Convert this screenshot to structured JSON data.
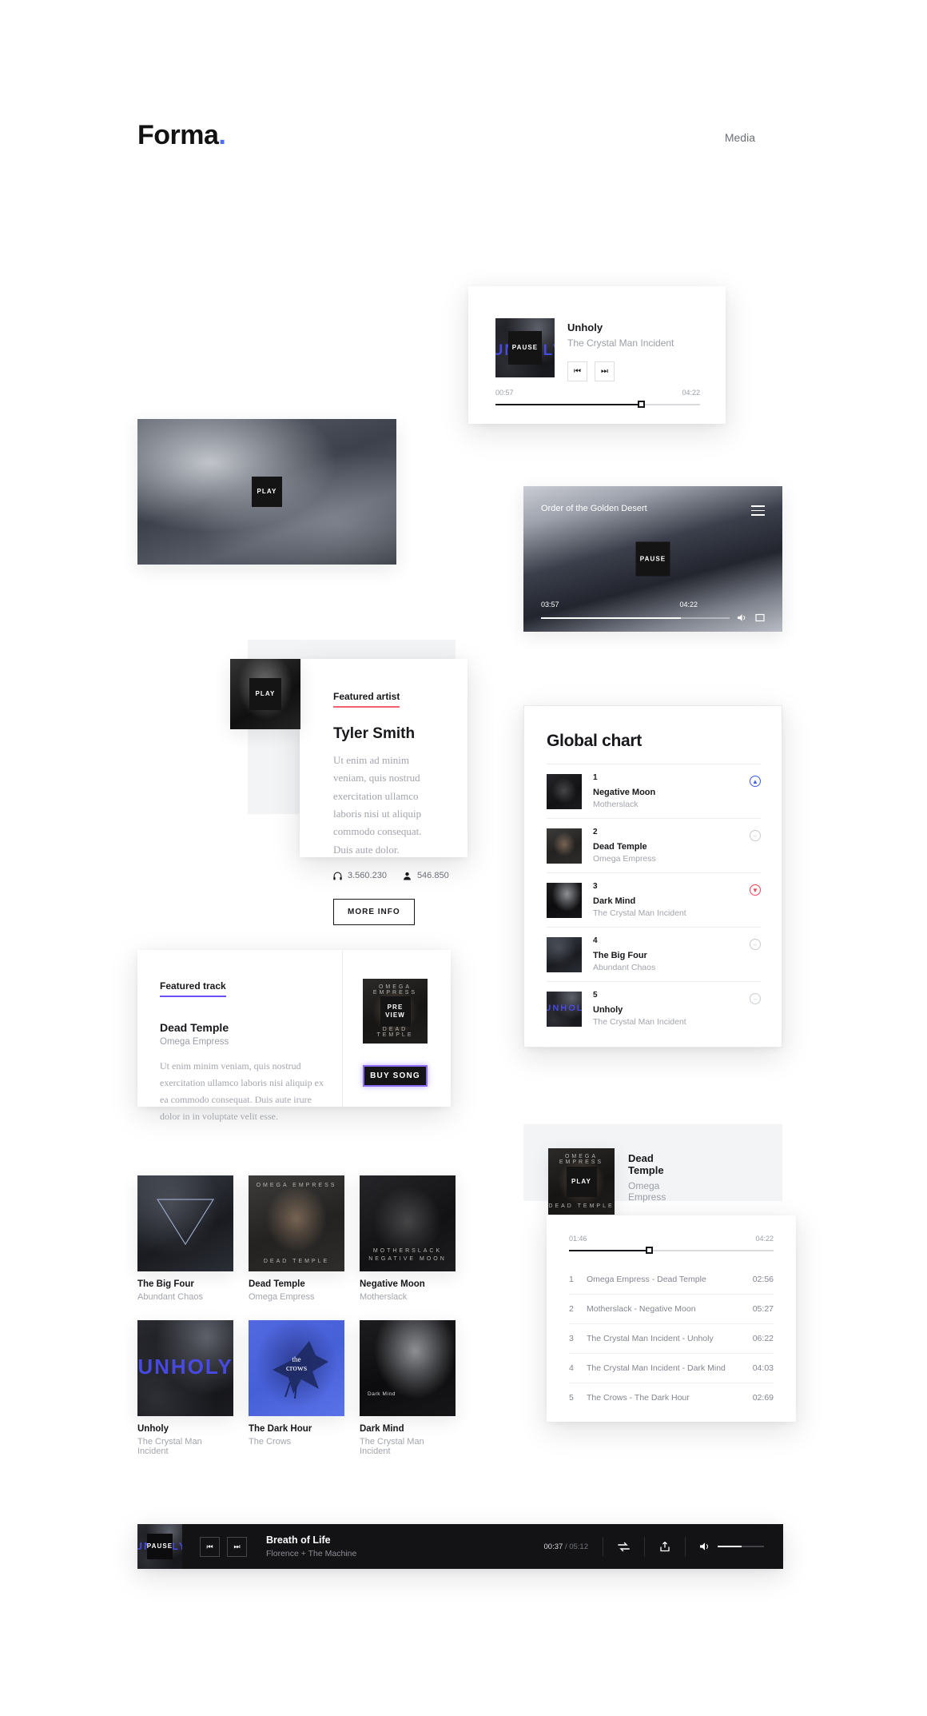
{
  "header": {
    "logo": "Forma",
    "logo_dot": ".",
    "nav": "Media"
  },
  "player_card": {
    "title": "Unholy",
    "artist": "The Crystal Man Incident",
    "overlay_label": "PAUSE",
    "art_text": "UNHOLY",
    "time_current": "00:57",
    "time_total": "04:22",
    "progress_pct": 71,
    "prev_icon": "skip-previous-icon",
    "next_icon": "skip-next-icon"
  },
  "hero_video": {
    "overlay_label": "PLAY"
  },
  "video_player": {
    "title": "Order of the Golden Desert",
    "overlay_label": "PAUSE",
    "time_current": "03:57",
    "time_total": "04:22",
    "progress_pct": 74,
    "menu_icon": "hamburger-icon",
    "volume_icon": "volume-icon",
    "fullscreen_icon": "fullscreen-icon"
  },
  "featured_artist": {
    "kicker": "Featured artist",
    "name": "Tyler Smith",
    "description": "Ut enim ad minim veniam, quis nostrud exercitation ullamco laboris nisi ut aliquip commodo consequat. Duis aute dolor.",
    "plays": "3.560.230",
    "followers": "546.850",
    "plays_icon": "headphones-icon",
    "followers_icon": "user-icon",
    "button": "MORE INFO",
    "overlay_label": "PLAY"
  },
  "global_chart": {
    "title": "Global chart",
    "rows": [
      {
        "rank": "1",
        "name": "Negative Moon",
        "artist": "Motherslack",
        "trend": "up",
        "trend_icon": "chevron-up-circle-icon"
      },
      {
        "rank": "2",
        "name": "Dead Temple",
        "artist": "Omega Empress",
        "trend": "flat",
        "trend_icon": "minus-circle-icon"
      },
      {
        "rank": "3",
        "name": "Dark Mind",
        "artist": "The Crystal Man Incident",
        "trend": "down",
        "trend_icon": "chevron-down-circle-icon"
      },
      {
        "rank": "4",
        "name": "The Big Four",
        "artist": "Abundant Chaos",
        "trend": "flat",
        "trend_icon": "minus-circle-icon"
      },
      {
        "rank": "5",
        "name": "Unholy",
        "artist": "The Crystal Man Incident",
        "trend": "flat",
        "trend_icon": "minus-circle-icon"
      }
    ]
  },
  "featured_track": {
    "kicker": "Featured track",
    "name": "Dead Temple",
    "artist": "Omega Empress",
    "description": "Ut enim minim veniam, quis nostrud exercitation ullamco laboris nisi aliquip ex ea commodo consequat. Duis aute irure dolor in in voluptate velit esse.",
    "preview_label_1": "PRE",
    "preview_label_2": "VIEW",
    "buy_label": "BUY SONG"
  },
  "albums": [
    {
      "name": "The Big Four",
      "artist": "Abundant Chaos"
    },
    {
      "name": "Dead Temple",
      "artist": "Omega Empress"
    },
    {
      "name": "Negative Moon",
      "artist": "Motherslack"
    },
    {
      "name": "Unholy",
      "artist": "The Crystal Man Incident"
    },
    {
      "name": "The Dark Hour",
      "artist": "The Crows"
    },
    {
      "name": "Dark Mind",
      "artist": "The Crystal Man Incident"
    }
  ],
  "album_art_labels": {
    "temple_top": "OMEGA EMPRESS",
    "temple_bottom": "DEAD TEMPLE",
    "typewriter_top": "MOTHERSLACK",
    "typewriter_bottom": "NEGATIVE MOON",
    "unholy": "UNHOLY",
    "crows_1": "the",
    "crows_2": "crows",
    "darkmind": "Dark Mind"
  },
  "playlist_player": {
    "title": "Dead Temple",
    "artist": "Omega Empress",
    "overlay_label": "PLAY",
    "time_current": "01:46",
    "time_total": "04:22",
    "progress_pct": 39,
    "tracks": [
      {
        "num": "1",
        "label": "Omega Empress - Dead Temple",
        "duration": "02:56"
      },
      {
        "num": "2",
        "label": "Motherslack - Negative Moon",
        "duration": "05:27"
      },
      {
        "num": "3",
        "label": "The Crystal Man Incident - Unholy",
        "duration": "06:22"
      },
      {
        "num": "4",
        "label": "The Crystal Man Incident - Dark Mind",
        "duration": "04:03"
      },
      {
        "num": "5",
        "label": "The Crows - The Dark Hour",
        "duration": "02:69"
      }
    ]
  },
  "bottom_bar": {
    "overlay_label": "PAUSE",
    "art_text": "UNHOLY",
    "title": "Breath of Life",
    "artist": "Florence + The Machine",
    "time_current": "00:37",
    "time_separator": "/",
    "time_total": "05:12",
    "repeat_icon": "repeat-icon",
    "share_icon": "share-icon",
    "volume_icon": "volume-icon",
    "volume_pct": 52
  },
  "colors": {
    "accent_blue": "#4a6cf7",
    "accent_red": "#f2626f",
    "accent_purple": "#6c4ff5",
    "trend_up": "#3a5ce8",
    "trend_down": "#ef4056",
    "dark": "#131316"
  }
}
